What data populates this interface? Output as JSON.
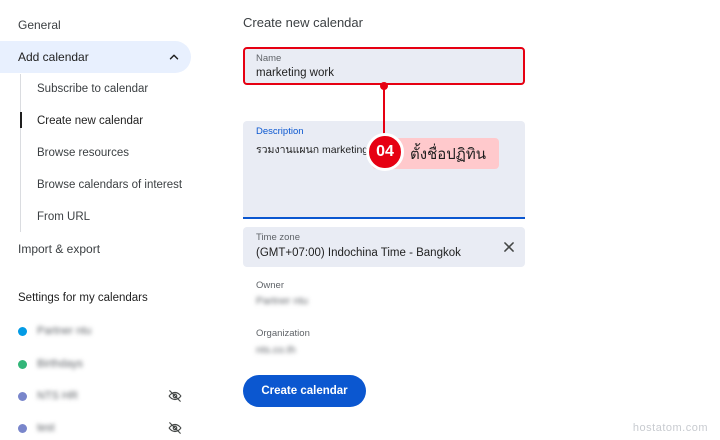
{
  "sidebar": {
    "general_label": "General",
    "add_calendar_label": "Add calendar",
    "sub_items": [
      {
        "label": "Subscribe to calendar"
      },
      {
        "label": "Create new calendar"
      },
      {
        "label": "Browse resources"
      },
      {
        "label": "Browse calendars of interest"
      },
      {
        "label": "From URL"
      }
    ],
    "import_export_label": "Import & export",
    "settings_title": "Settings for my calendars",
    "calendars": [
      {
        "label": "Partner ntu",
        "color": "#039be5",
        "hidden": false
      },
      {
        "label": "Birthdays",
        "color": "#33b679",
        "hidden": false
      },
      {
        "label": "NTS HR",
        "color": "#7986cb",
        "hidden": true
      },
      {
        "label": "test",
        "color": "#7986cb",
        "hidden": true
      }
    ]
  },
  "form": {
    "title": "Create new calendar",
    "name_label": "Name",
    "name_value": "marketing work",
    "description_label": "Description",
    "description_value": "รวมงานแผนก marketing",
    "timezone_label": "Time zone",
    "timezone_value": "(GMT+07:00) Indochina Time - Bangkok",
    "owner_label": "Owner",
    "owner_value": "Partner ntu",
    "organization_label": "Organization",
    "organization_value": "nts.co.th",
    "create_button": "Create calendar"
  },
  "annotation": {
    "step": "04",
    "text": "ตั้งชื่อปฏิทิน",
    "color": "#e60012"
  },
  "watermark": "hostatom.com",
  "colors": {
    "accent": "#0b57d0",
    "selected_bg": "#e8f0fe",
    "field_bg": "#e9ecf4"
  }
}
